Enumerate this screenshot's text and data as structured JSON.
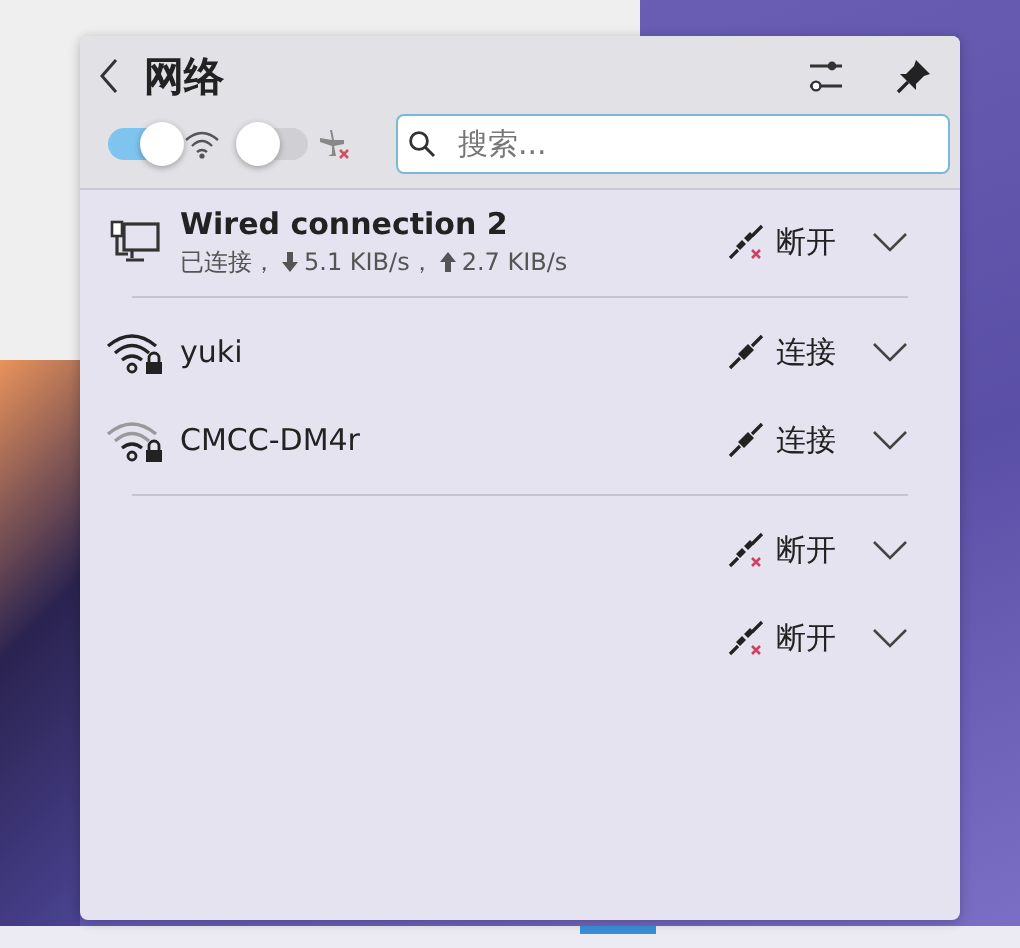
{
  "panel": {
    "title": "网络"
  },
  "toggles": [
    {
      "kind": "wifi",
      "on": true
    },
    {
      "kind": "airplane",
      "on": false
    }
  ],
  "search": {
    "placeholder": "搜索..."
  },
  "groups": [
    {
      "connections": [
        {
          "kind": "wired",
          "name": "Wired connection 2",
          "status": "已连接，",
          "download": "5.1 KIB/s，",
          "upload": "2.7 KIB/s",
          "action": {
            "kind": "disconnect",
            "label": "断开"
          }
        }
      ]
    },
    {
      "connections": [
        {
          "kind": "wifi",
          "name": "yuki",
          "action": {
            "kind": "connect",
            "label": "连接"
          }
        },
        {
          "kind": "wifi-weak",
          "name": "CMCC-DM4r",
          "action": {
            "kind": "connect",
            "label": "连接"
          }
        }
      ]
    },
    {
      "connections": [
        {
          "kind": "none",
          "action": {
            "kind": "disconnect",
            "label": "断开"
          }
        },
        {
          "kind": "none",
          "action": {
            "kind": "disconnect",
            "label": "断开"
          }
        }
      ]
    }
  ]
}
